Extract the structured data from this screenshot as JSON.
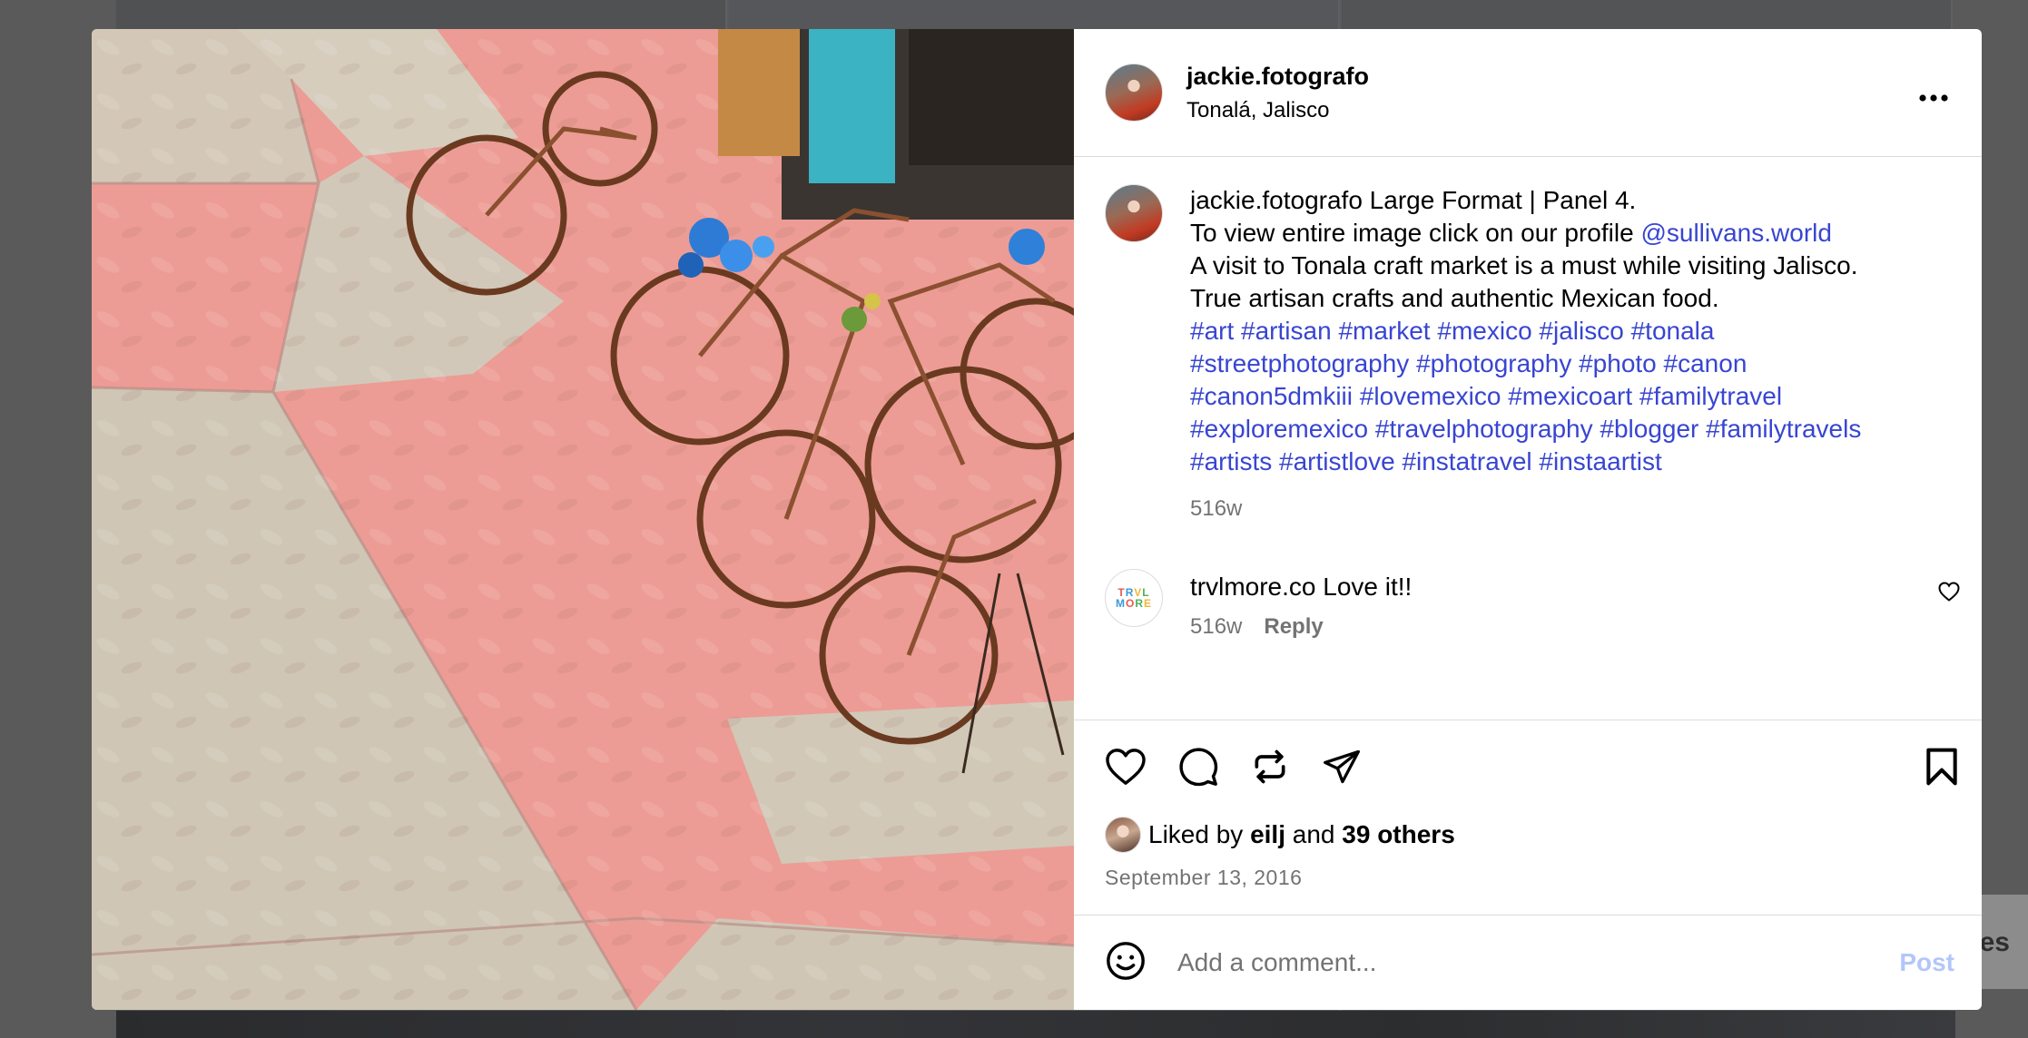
{
  "background": {
    "peek_text": "es"
  },
  "post": {
    "username": "jackie.fotografo",
    "location": "Tonalá, Jalisco",
    "more_label": "•••",
    "caption": {
      "username": "jackie.fotografo",
      "line1": "Large Format | Panel 4.",
      "line2_prefix": "To view entire image click on our profile ",
      "mention": "@sullivans.world",
      "line3": "A visit to Tonala craft market is a must while visiting Jalisco.",
      "line4": "True artisan crafts and authentic Mexican food.",
      "hashtags": [
        "#art",
        "#artisan",
        "#market",
        "#mexico",
        "#jalisco",
        "#tonala",
        "#streetphotography",
        "#photography",
        "#photo",
        "#canon",
        "#canon5dmkiii",
        "#lovemexico",
        "#mexicoart",
        "#familytravel",
        "#exploremexico",
        "#travelphotography",
        "#blogger",
        "#familytravels",
        "#artists",
        "#artistlove",
        "#instatravel",
        "#instaartist"
      ],
      "time": "516w"
    },
    "comments": [
      {
        "username": "trvlmore.co",
        "text": "Love it!!",
        "time": "516w",
        "reply_label": "Reply",
        "avatar_line1": "TRVL",
        "avatar_line2": "MORE"
      }
    ],
    "likes": {
      "prefix": "Liked by ",
      "user": "eilj",
      "middle": " and ",
      "others": "39 others"
    },
    "date": "September 13, 2016",
    "comment_input": {
      "placeholder": "Add a comment...",
      "post_label": "Post"
    }
  },
  "icons": {
    "like": "heart-icon",
    "comment": "comment-bubble-icon",
    "repost": "repost-icon",
    "share": "send-icon",
    "save": "bookmark-icon",
    "emoji": "smiley-icon",
    "comment_like": "small-heart-icon"
  },
  "colors": {
    "link": "#3845d1",
    "post_button": "#b3c6fb",
    "muted": "#737373",
    "tile_pink": "#ec9c94",
    "tile_grey": "#d7cdbf"
  }
}
